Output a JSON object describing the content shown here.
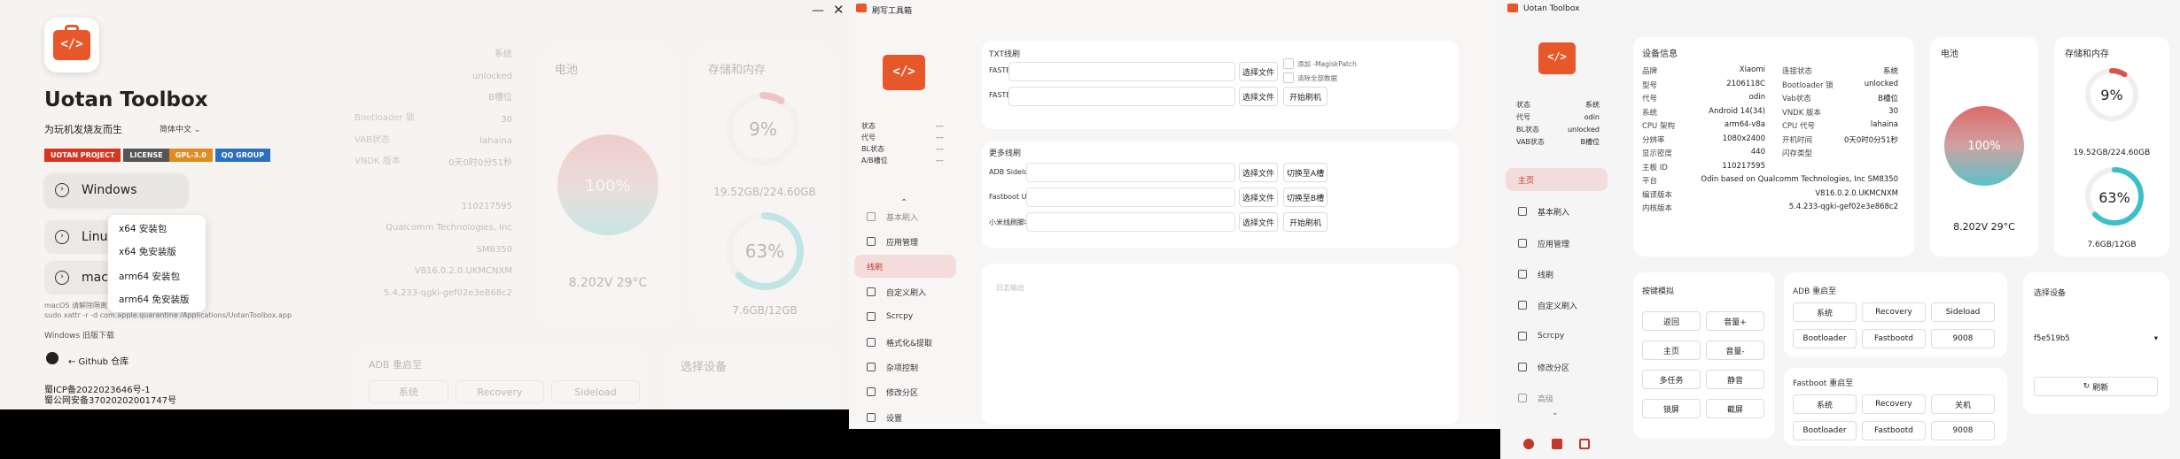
{
  "p1": {
    "app_title": "Uotan Toolbox",
    "subtitle": "为玩机发烧友而生",
    "lang_select": "简体中文",
    "badges": [
      {
        "text": "UOTAN PROJECT",
        "color": "#d9341f"
      },
      {
        "text": "LICENSE",
        "color": "#555555"
      },
      {
        "text": "GPL-3.0",
        "color": "#e08b1f"
      },
      {
        "text": "QQ GROUP",
        "color": "#2c6fbe"
      }
    ],
    "os_buttons": [
      "Windows",
      "Linux",
      "macOS"
    ],
    "dropdown": [
      "x64 安装包",
      "x64 免安装版",
      "arm64 安装包",
      "arm64 免安装版"
    ],
    "note1": "macOS 请解除隔离",
    "note2": "sudo xattr -r -d com.apple.quarantine /Applications/UotanToolbox.app",
    "note3": "Windows 旧版下载",
    "github": "← Github 仓库",
    "icp1": "蜀ICP备2022023646号-1",
    "icp2": "蜀公网安备37020202001747号",
    "bg": {
      "rows": [
        "系统",
        "unlocked",
        "B槽位",
        "30",
        "lahaina",
        "0天0时0分51秒",
        "",
        "110217595",
        "Qualcomm Technologies, Inc SM8350",
        "V816.0.2.0.UKMCNXM",
        "5.4.233-qgki-gef02e3e868c2"
      ],
      "left_rows": [
        "Bootloader 锁",
        "VAB状态",
        "VNDK 版本"
      ],
      "battery_title": "电池",
      "battery_pct": "100%",
      "battery_info": "8.202V 29°C",
      "storage_title": "存储和内存",
      "storage_pct": "9%",
      "storage_info": "19.52GB/224.60GB",
      "memory_pct": "63%",
      "memory_info": "7.6GB/12GB",
      "reboot_title": "ADB 重启至",
      "reboot_btns": [
        "系统",
        "Recovery",
        "Sideload"
      ],
      "select_title": "选择设备"
    }
  },
  "p2": {
    "window_title": "刷写工具箱",
    "status_labels": [
      "状态",
      "代号",
      "BL状态",
      "A/B槽位"
    ],
    "status_values": [
      "---",
      "---",
      "---",
      "---"
    ],
    "nav": [
      "基本刷入",
      "应用管理",
      "线刷",
      "自定义刷入",
      "Scrcpy",
      "格式化&提取",
      "杂项控制",
      "修改分区",
      "设置"
    ],
    "txt_section": "TXT线刷",
    "txt_rows": [
      "FASTBOOT",
      "FASTBOOTD"
    ],
    "checks": [
      "添加 -MagiskPatch",
      "清除全部数据"
    ],
    "select_file": "选择文件",
    "start_flash": "开始刷机",
    "more_section": "更多线刷",
    "more_rows": [
      "ADB Sideload",
      "Fastboot Updated",
      "小米线刷脚本"
    ],
    "action_btns": [
      "切换至A槽",
      "切换至B槽",
      "开始刷机"
    ],
    "log_placeholder": "日志输出"
  },
  "p3": {
    "window_title": "Uotan Toolbox",
    "status_labels": [
      "状态",
      "代号",
      "BL状态",
      "VAB状态"
    ],
    "status_values": [
      "系统",
      "odin",
      "unlocked",
      "B槽位"
    ],
    "nav": [
      "主页",
      "基本刷入",
      "应用管理",
      "线刷",
      "自定义刷入",
      "Scrcpy",
      "修改分区",
      "高级"
    ],
    "device_title": "设备信息",
    "dev_left": [
      [
        "品牌",
        "Xiaomi"
      ],
      [
        "型号",
        "2106118C"
      ],
      [
        "代号",
        "odin"
      ],
      [
        "系统",
        "Android 14(34)"
      ],
      [
        "CPU 架构",
        "arm64-v8a"
      ],
      [
        "分辨率",
        "1080x2400"
      ],
      [
        "显示密度",
        "440"
      ],
      [
        "主板 ID",
        "110217595"
      ],
      [
        "平台",
        "Odin based on Qualcomm Technologies, Inc SM8350"
      ],
      [
        "编译版本",
        "V816.0.2.0.UKMCNXM"
      ],
      [
        "内核版本",
        "5.4.233-qgki-gef02e3e868c2"
      ]
    ],
    "dev_right": [
      [
        "连接状态",
        "系统"
      ],
      [
        "Bootloader 锁",
        "unlocked"
      ],
      [
        "Vab状态",
        "B槽位"
      ],
      [
        "VNDK 版本",
        "30"
      ],
      [
        "CPU 代号",
        "lahaina"
      ],
      [
        "开机时间",
        "0天0时0分51秒"
      ],
      [
        "闪存类型",
        ""
      ]
    ],
    "battery_title": "电池",
    "battery_pct": "100%",
    "battery_info": "8.202V 29°C",
    "storage_title": "存储和内存",
    "storage_pct": "9%",
    "storage_info": "19.52GB/224.60GB",
    "memory_pct": "63%",
    "memory_info": "7.6GB/12GB",
    "keys_title": "按键模拟",
    "keys": [
      [
        "返回",
        "音量+"
      ],
      [
        "主页",
        "音量-"
      ],
      [
        "多任务",
        "静音"
      ],
      [
        "锁屏",
        "截屏"
      ]
    ],
    "adb_title": "ADB 重启至",
    "adb_btns": [
      "系统",
      "Recovery",
      "Sideload",
      "Bootloader",
      "Fastbootd",
      "9008"
    ],
    "fb_title": "Fastboot 重启至",
    "fb_btns": [
      "系统",
      "Recovery",
      "关机",
      "Bootloader",
      "Fastbootd",
      "9008"
    ],
    "select_title": "选择设备",
    "device_id": "f5e519b5",
    "refresh": "刷新"
  },
  "colors": {
    "brand": "#e8572a",
    "accent": "#c0392b",
    "teal": "#3cbfc9",
    "ring_red": "#d9534f"
  }
}
